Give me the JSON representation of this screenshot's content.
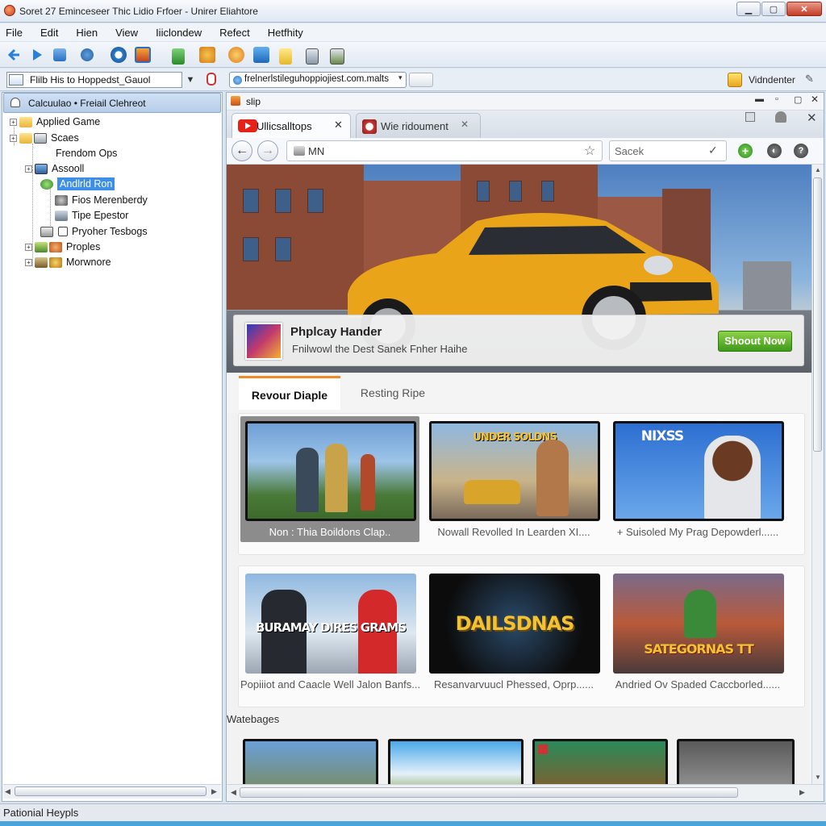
{
  "window": {
    "title": "Soret 27 Eminceseer  Thic Lidio Frfoer - Unirer Eliahtore",
    "min_label": "▁",
    "max_label": "▢",
    "close_label": "✕"
  },
  "menu": [
    "File",
    "Edit",
    "Hien",
    "View",
    "Iiiclondew",
    "Refect",
    "Hetfhity"
  ],
  "address_row": {
    "combo_value": "Flilb His to Hoppedst_Gauol",
    "url_combo_value": "frelnerlstileguhoppiojiest.com.malts",
    "right_label": "Vidndenter"
  },
  "left_panel": {
    "header": "Calcuulao • Freiail Clehreot",
    "tree": [
      {
        "label": "Applied Game",
        "icon": "folder-icon"
      },
      {
        "label": "Scaes",
        "icon": "folder-icon"
      },
      {
        "label": "Frendom Ops",
        "icon": "none"
      },
      {
        "label": "Assooll",
        "icon": "monitor-icon"
      },
      {
        "label": "Andlrld Ron",
        "icon": "android-icon",
        "selected": true
      },
      {
        "label": "Fios Merenberdy",
        "icon": "gear-icon"
      },
      {
        "label": "Tipe Epestor",
        "icon": "tool-icon"
      },
      {
        "label": "Pryoher Tesbogs",
        "icon": "checkbox-icon"
      },
      {
        "label": "Proples",
        "icon": "people-icon"
      },
      {
        "label": "Morwnore",
        "icon": "puzzle-icon"
      }
    ]
  },
  "status": {
    "text": "Pationial Heypls"
  },
  "browser": {
    "header_label": "slip",
    "tabs": [
      {
        "label": "Ullicsalltops",
        "active": true
      },
      {
        "label": "Wie ridoument",
        "active": false
      }
    ],
    "url": "MN",
    "search_placeholder": "Sacek"
  },
  "promo": {
    "title": "Phplcay Hander",
    "subtitle": "Fnilwowl the Dest Sanek Fnher Haihe",
    "button": "Shoout Now"
  },
  "content_tabs": [
    "Revour Diaple",
    "Resting Ripe"
  ],
  "featured_cards": [
    {
      "caption": "Non : Thia Boildons Clap..",
      "thumb_text": ""
    },
    {
      "caption": "Nowall Revolled In Learden XI....",
      "thumb_text": "UNDER SOLDNS"
    },
    {
      "caption": "+ Suisoled My Prag Depowderl......",
      "thumb_text": "NIXSS"
    }
  ],
  "second_cards": [
    {
      "caption": "Popiiiot and Caacle Well Jalon Banfs.....",
      "thumb_text": "BURAMAY DIRES GRAMS"
    },
    {
      "caption": "Resanvarvuucl Phessed, Oprp......",
      "thumb_text": "DAILSDNAS"
    },
    {
      "caption": "Andried Ov Spaded Caccborled......",
      "thumb_text": "SATEGORNAS TT"
    }
  ],
  "more_label": "Watebages",
  "colors": {
    "accent_tab": "#f08a24",
    "shop_button": "#4caa1f",
    "selection": "#3d8ee8",
    "youtube_red": "#e62117"
  }
}
